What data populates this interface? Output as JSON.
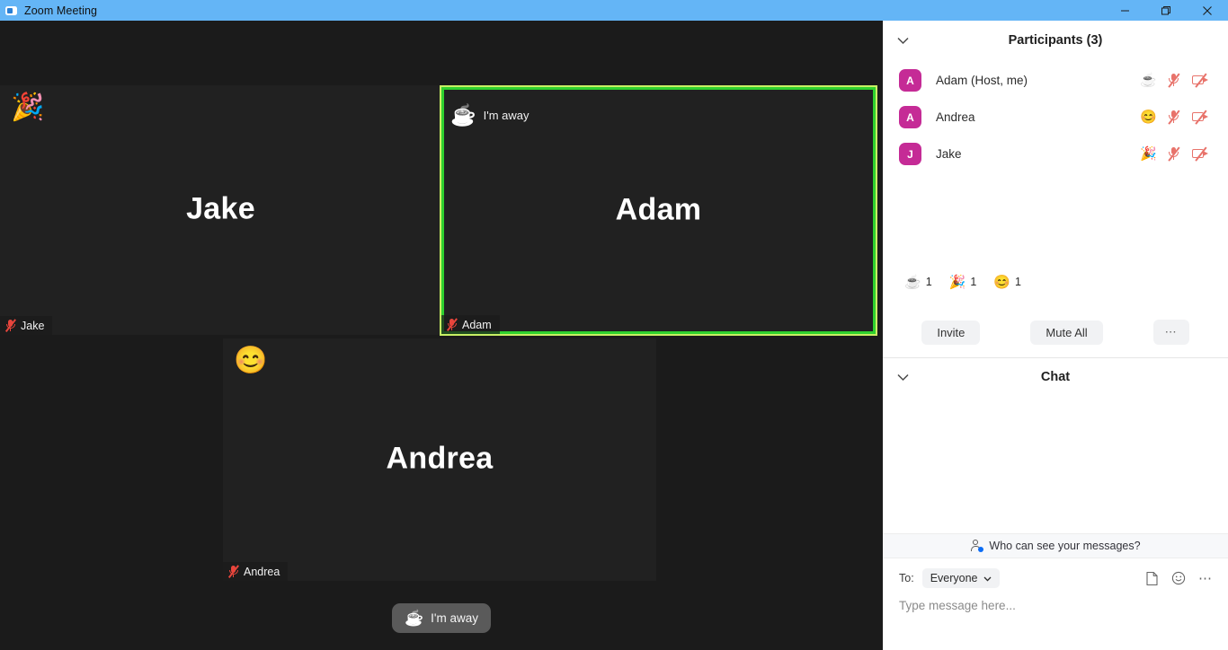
{
  "titlebar": {
    "app_icon": "zoom-camera-icon",
    "title": "Zoom Meeting",
    "minimize_label": "–",
    "maximize_label": "❐",
    "close_label": "✕"
  },
  "stage": {
    "background_color": "#1b1b1b",
    "active_border_outer": "#c8f064",
    "active_border_inner": "#2fd12f",
    "tiles": [
      {
        "id": "jake",
        "name": "Jake",
        "footer_name": "Jake",
        "reaction": "🎉",
        "reaction_name": "party-popper-reaction",
        "status_text": null,
        "muted": true,
        "active_speaker": false
      },
      {
        "id": "adam",
        "name": "Adam",
        "footer_name": "Adam",
        "reaction": null,
        "reaction_name": null,
        "status_icon": "☕",
        "status_text": "I'm away",
        "muted": true,
        "active_speaker": true
      },
      {
        "id": "andrea",
        "name": "Andrea",
        "footer_name": "Andrea",
        "reaction": "😊",
        "reaction_name": "smiling-face-reaction",
        "status_text": null,
        "muted": true,
        "active_speaker": false
      }
    ]
  },
  "toolbar": {
    "away_icon": "☕",
    "away_label": "I'm away"
  },
  "panel": {
    "participants": {
      "title": "Participants (3)",
      "collapse_icon": "chevron-down-icon",
      "rows": [
        {
          "initial": "A",
          "name": "Adam (Host, me)",
          "status_emoji": "☕",
          "status_name": "coffee-cup-status-icon",
          "muted": true,
          "video_off": true
        },
        {
          "initial": "A",
          "name": "Andrea",
          "status_emoji": "😊",
          "status_name": "smiling-face-status-icon",
          "muted": true,
          "video_off": true
        },
        {
          "initial": "J",
          "name": "Jake",
          "status_emoji": "🎉",
          "status_name": "party-popper-status-icon",
          "muted": true,
          "video_off": true
        }
      ],
      "avatar_color": "#c52b96"
    },
    "reactions": [
      {
        "emoji": "☕",
        "icon_name": "coffee-cup-reaction",
        "count": "1",
        "gray": true
      },
      {
        "emoji": "🎉",
        "icon_name": "party-popper-reaction",
        "count": "1",
        "gray": false
      },
      {
        "emoji": "😊",
        "icon_name": "smiling-face-reaction",
        "count": "1",
        "gray": false
      }
    ],
    "actions": {
      "invite_label": "Invite",
      "mute_all_label": "Mute All",
      "more_label": "⋯"
    },
    "chat": {
      "title": "Chat",
      "collapse_icon": "chevron-down-icon",
      "privacy_text": "Who can see your messages?",
      "to_label": "To:",
      "to_value": "Everyone",
      "to_chevron": "˅",
      "message_placeholder": "Type message here...",
      "file_icon": "file-icon",
      "emoji_icon": "emoji-icon",
      "more_icon": "⋯"
    }
  }
}
